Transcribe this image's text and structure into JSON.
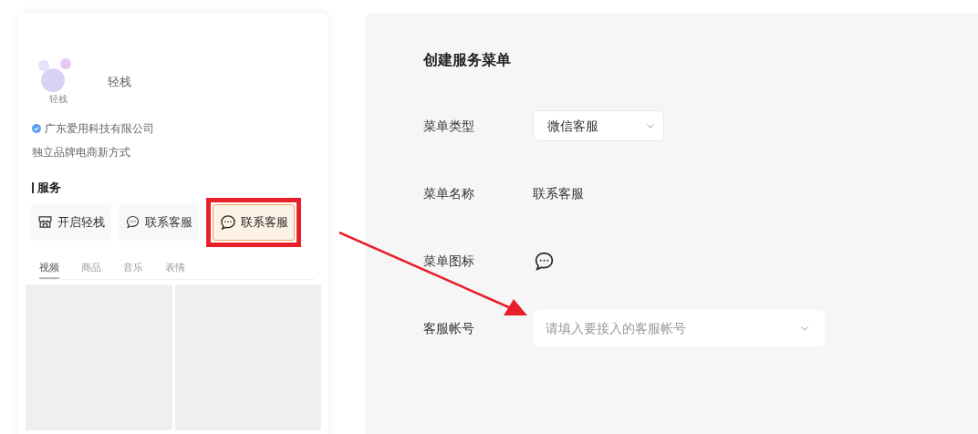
{
  "profile": {
    "name": "轻栈",
    "logo_text": "轻栈",
    "company": "广东爱用科技有限公司",
    "verified": true,
    "slogan": "独立品牌电商新方式"
  },
  "services": {
    "title": "服务",
    "buttons": [
      {
        "label": "开启轻栈",
        "kind": "store",
        "selected": false
      },
      {
        "label": "联系客服",
        "kind": "chat",
        "selected": false
      },
      {
        "label": "联系客服",
        "kind": "chat",
        "selected": true
      }
    ]
  },
  "tabs": [
    {
      "label": "视频",
      "selected": true
    },
    {
      "label": "商品",
      "selected": false
    },
    {
      "label": "音乐",
      "selected": false
    },
    {
      "label": "表情",
      "selected": false
    }
  ],
  "form": {
    "title": "创建服务菜单",
    "rows": [
      {
        "kind": "select",
        "label": "菜单类型",
        "value": "微信客服"
      },
      {
        "kind": "text",
        "label": "菜单名称",
        "value": "联系客服"
      },
      {
        "kind": "icon",
        "label": "菜单图标"
      },
      {
        "kind": "select_wide",
        "label": "客服帐号",
        "placeholder": "请填入要接入的客服帐号"
      }
    ]
  }
}
